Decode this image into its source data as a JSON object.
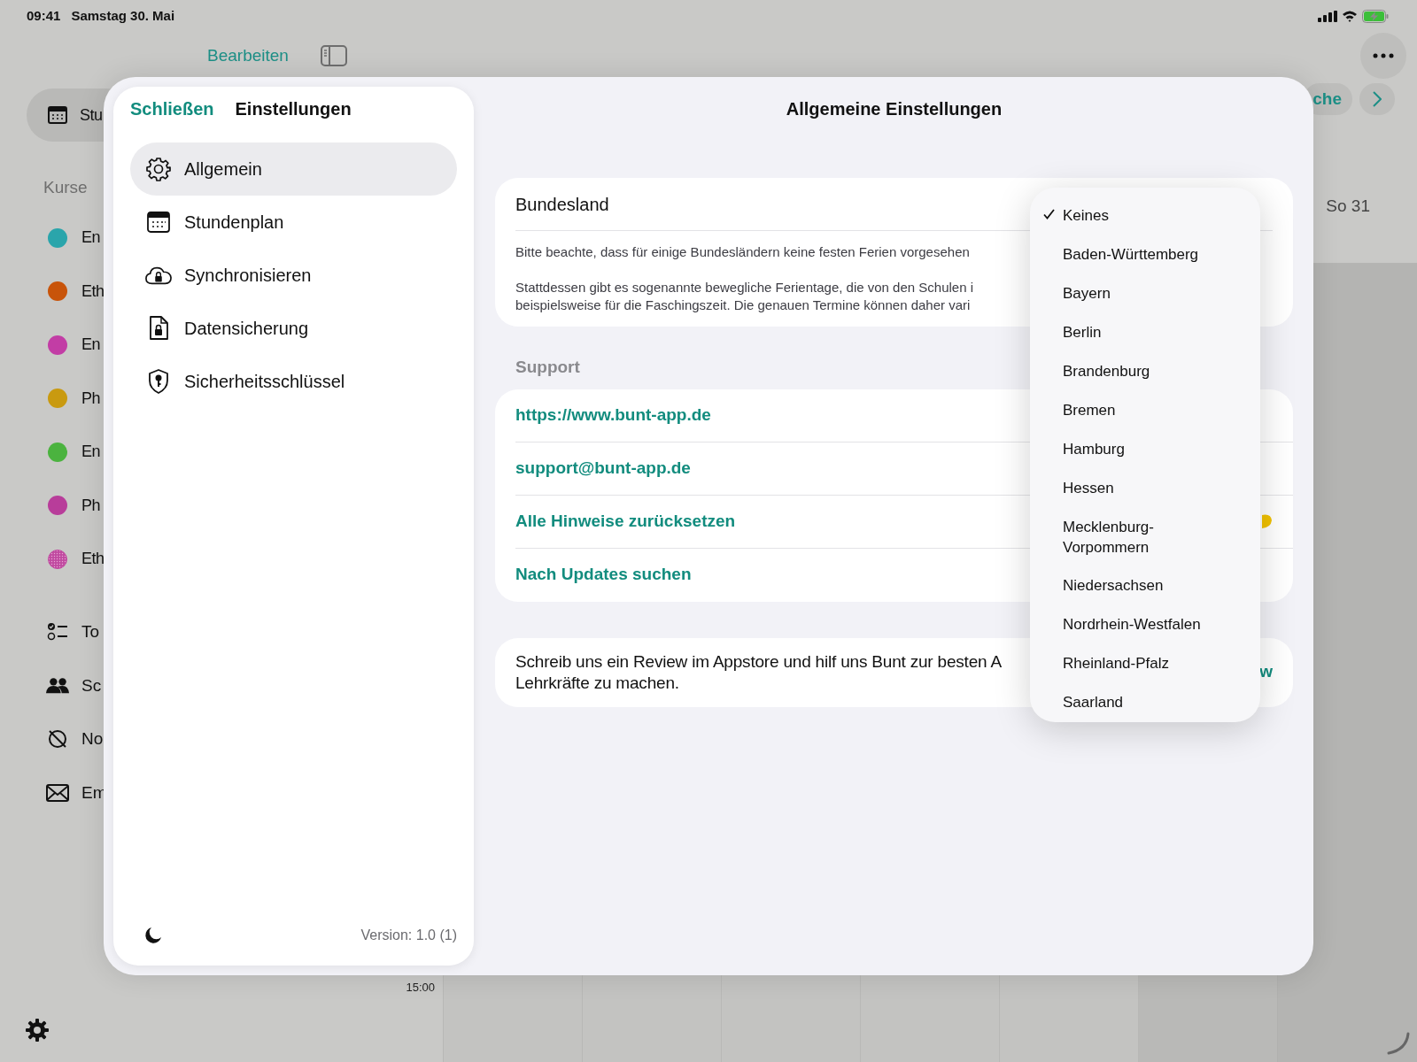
{
  "status_bar": {
    "time": "09:41",
    "date": "Samstag 30. Mai"
  },
  "toolbar": {
    "edit": "Bearbeiten"
  },
  "background_sidebar": {
    "top_item": {
      "label": "Stu",
      "selected": true
    },
    "section_header": "Kurse",
    "courses": [
      {
        "label": "En",
        "color": "#2aa5ab",
        "kind": "solid"
      },
      {
        "label": "Eth",
        "color": "#c8540a",
        "kind": "solid"
      },
      {
        "label": "En",
        "color": "#c23da5",
        "kind": "solid"
      },
      {
        "label": "Ph",
        "color": "#c99a10",
        "kind": "solid"
      },
      {
        "label": "En",
        "color": "#4bb33f",
        "kind": "solid"
      },
      {
        "label": "Ph",
        "color": "#b83d9a",
        "kind": "solid"
      },
      {
        "label": "Eth",
        "color": "#c04aa0",
        "kind": "dotted"
      }
    ],
    "items": [
      {
        "label": "To"
      },
      {
        "label": "Sc"
      },
      {
        "label": "No"
      },
      {
        "label": "Em"
      }
    ]
  },
  "calendar": {
    "week_button": "che",
    "day_header": "So 31",
    "time_label": "15:00"
  },
  "settings": {
    "close": "Schließen",
    "title": "Einstellungen",
    "nav": [
      {
        "label": "Allgemein",
        "selected": true
      },
      {
        "label": "Stundenplan",
        "selected": false
      },
      {
        "label": "Synchronisieren",
        "selected": false
      },
      {
        "label": "Datensicherung",
        "selected": false
      },
      {
        "label": "Sicherheitsschlüssel",
        "selected": false
      }
    ],
    "version": "Version: 1.0 (1)"
  },
  "general": {
    "title": "Allgemeine Einstellungen",
    "state_row": {
      "label": "Bundesland"
    },
    "notes": [
      "Bitte beachte, dass für einige Bundesländern keine festen Ferien vorgesehen",
      "Stattdessen gibt es sogenannte bewegliche Ferientage, die von den Schulen i\nbeispielsweise für die Faschingszeit. Die genauen Termine können daher vari"
    ],
    "support": {
      "header": "Support",
      "links": [
        "https://www.bunt-app.de",
        "support@bunt-app.de",
        "Alle Hinweise zurücksetzen",
        "Nach Updates suchen"
      ]
    },
    "review": {
      "text": "Schreib uns ein Review im Appstore und hilf uns Bunt zur besten A\nLehrkräfte zu machen.",
      "action": "w"
    }
  },
  "state_menu": {
    "options": [
      {
        "label": "Keines",
        "selected": true
      },
      {
        "label": "Baden-Württemberg",
        "selected": false
      },
      {
        "label": "Bayern",
        "selected": false
      },
      {
        "label": "Berlin",
        "selected": false
      },
      {
        "label": "Brandenburg",
        "selected": false
      },
      {
        "label": "Bremen",
        "selected": false
      },
      {
        "label": "Hamburg",
        "selected": false
      },
      {
        "label": "Hessen",
        "selected": false
      },
      {
        "label": "Mecklenburg-Vorpommern",
        "selected": false
      },
      {
        "label": "Niedersachsen",
        "selected": false
      },
      {
        "label": "Nordrhein-Westfalen",
        "selected": false
      },
      {
        "label": "Rheinland-Pfalz",
        "selected": false
      },
      {
        "label": "Saarland",
        "selected": false
      }
    ]
  }
}
